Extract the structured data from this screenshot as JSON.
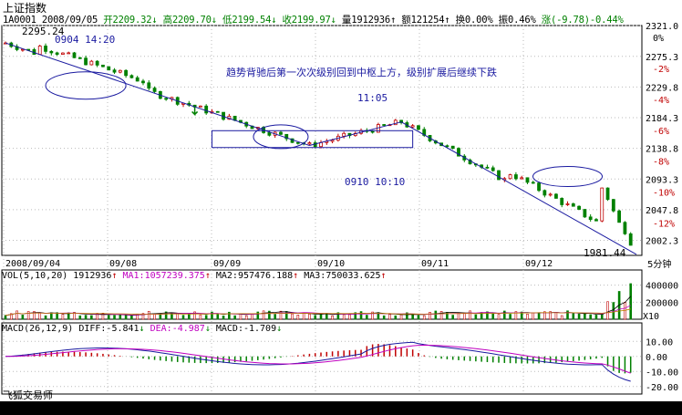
{
  "window": {
    "title": "上证指数"
  },
  "quote": {
    "code": "1A0001",
    "date": "2008/09/05",
    "open_label": "开",
    "open": "2209.32",
    "high_label": "高",
    "high": "2209.70",
    "low_label": "低",
    "low": "2199.54",
    "close_label": "收",
    "close": "2199.97",
    "volume_label": "量",
    "volume": "1912936",
    "amount_label": "额",
    "amount": "121254",
    "turnover_label": "换",
    "turnover": "0.00%",
    "amplitude_label": "振",
    "amplitude": "0.46%",
    "change_label": "涨",
    "change": "(-9.78)",
    "change_pct": "-0.44%"
  },
  "annotations": {
    "main_note": "趋势背驰后第一次次级别回到中枢上方，级别扩展后继续下跌",
    "start_price": "2295.24",
    "start_time": "0904 14:20",
    "mid_high_time": "11:05",
    "mid_low_time": "0910 10:10",
    "end_price": "1981.44"
  },
  "chart_data": [
    {
      "type": "line",
      "name": "price",
      "x_ticks": [
        "2008/09/04",
        "09/08",
        "09/09",
        "09/10",
        "09/11",
        "09/12"
      ],
      "y_ticks": [
        "2321.0",
        "2275.3",
        "2229.8",
        "2184.3",
        "2138.8",
        "2093.3",
        "2047.8",
        "2002.3"
      ],
      "pct_ticks": [
        "0%",
        "-2%",
        "-4%",
        "-6%",
        "-8%",
        "-10%",
        "-12%"
      ],
      "period_label": "5分钟",
      "ylim": [
        1980,
        2321
      ],
      "trend_lines": [
        {
          "from": [
            0,
            2295.24
          ],
          "to": [
            53,
            2143
          ]
        },
        {
          "from": [
            53,
            2143
          ],
          "to": [
            69,
            2178
          ]
        },
        {
          "from": [
            69,
            2178
          ],
          "to": [
            110,
            1981.44
          ]
        }
      ],
      "center_box": {
        "x0": 36,
        "x1": 71,
        "y0": 2165,
        "y1": 2140
      }
    },
    {
      "type": "bar",
      "name": "volume",
      "indicator": "VOL(5,10,20)",
      "value": "1912936",
      "ma1_label": "MA1:",
      "ma1": "1057239.375",
      "ma2_label": "MA2:",
      "ma2": "957476.188",
      "ma3_label": "MA3:",
      "ma3": "750033.625",
      "y_ticks": [
        "400000",
        "200000"
      ],
      "unit": "X10"
    },
    {
      "type": "bar",
      "name": "macd",
      "indicator": "MACD(26,12,9)",
      "diff_label": "DIFF:",
      "diff": "-5.841",
      "dea_label": "DEA:",
      "dea": "-4.987",
      "macd_label": "MACD:",
      "macd": "-1.709",
      "y_ticks": [
        "10.00",
        "0.00",
        "-10.00",
        "-20.00"
      ]
    }
  ],
  "credit": "飞狐交易师"
}
